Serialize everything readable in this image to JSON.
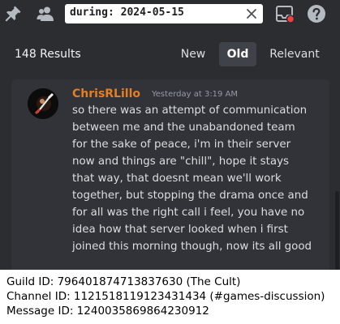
{
  "search": {
    "query": "during: 2024-05-15"
  },
  "results": {
    "count_label": "148 Results",
    "sort_options": [
      "New",
      "Old",
      "Relevant"
    ],
    "active_sort": "Old"
  },
  "message": {
    "author": "ChrisRLillo",
    "author_color": "#e67e22",
    "timestamp": "Yesterday at 3:19 AM",
    "lines": [
      "so there was an attempt of communication",
      "between me and the unabandoned team",
      "for the sake of peace, i'm in their server",
      "now and things are \"chill\", hope it stays",
      "that way, that doesnt mean we'll work",
      "together, but stopping the drama once and",
      "for all was the right call i feel, you have no",
      "idea how that server looked when i first",
      "joined this morning though, now its all good"
    ]
  },
  "caption": {
    "guild": "Guild ID: 796401874713837630 (The Cult)",
    "channel": "Channel ID: 1121518119123431434 (#games-discussion)",
    "message": "Message ID: 1240035869864230912"
  },
  "icons": [
    "pin-icon",
    "members-icon",
    "clear-search-icon",
    "inbox-icon",
    "help-icon"
  ]
}
